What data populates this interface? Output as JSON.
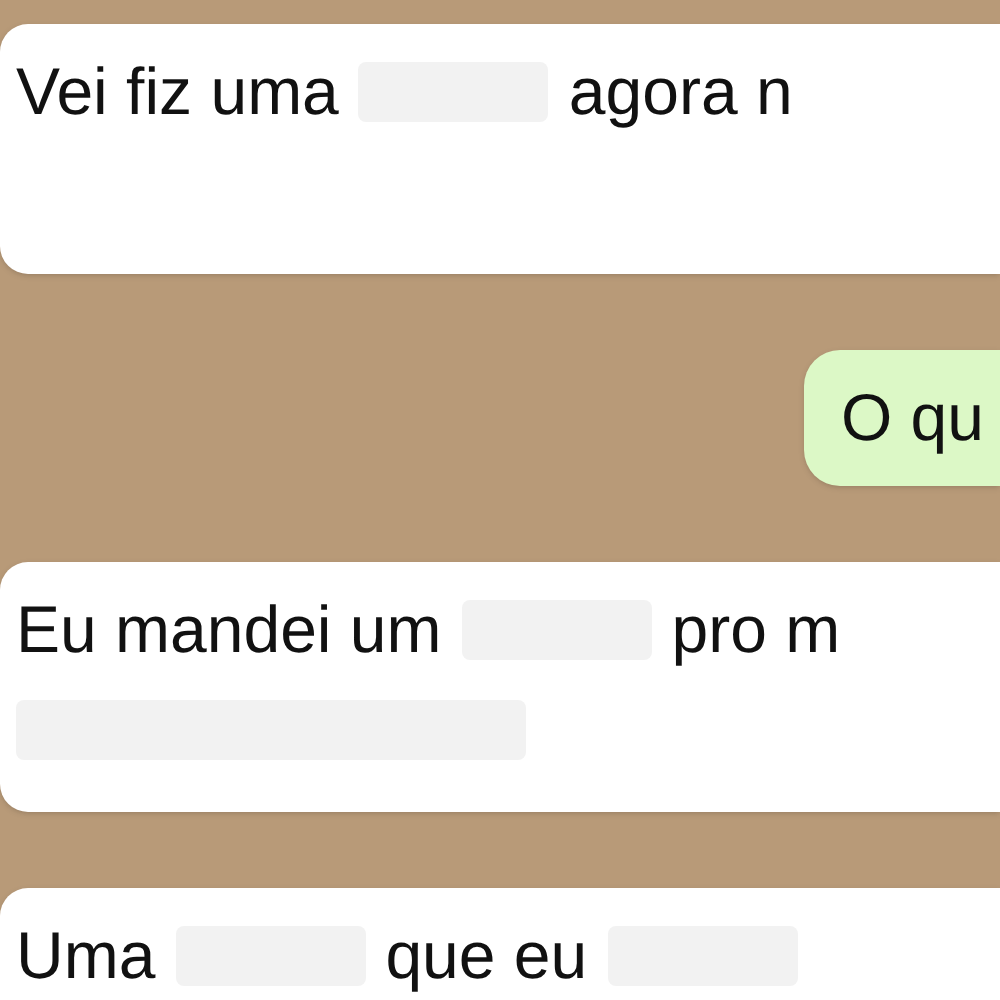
{
  "messages": [
    {
      "kind": "incoming",
      "lines": [
        [
          {
            "kind": "text",
            "text": "Vei fiz uma"
          },
          {
            "kind": "redacted"
          },
          {
            "kind": "text",
            "text": "agora n"
          }
        ]
      ]
    },
    {
      "kind": "outgoing",
      "lines": [
        [
          {
            "kind": "text",
            "text": "O qu"
          }
        ]
      ]
    },
    {
      "kind": "incoming",
      "lines": [
        [
          {
            "kind": "text",
            "text": "Eu mandei um"
          },
          {
            "kind": "redacted"
          },
          {
            "kind": "text",
            "text": "pro m"
          }
        ],
        [
          {
            "kind": "redacted_line"
          }
        ]
      ]
    },
    {
      "kind": "incoming",
      "lines": [
        [
          {
            "kind": "text",
            "text": "Uma"
          },
          {
            "kind": "redacted"
          },
          {
            "kind": "text",
            "text": "que eu"
          },
          {
            "kind": "redacted"
          }
        ]
      ]
    }
  ]
}
